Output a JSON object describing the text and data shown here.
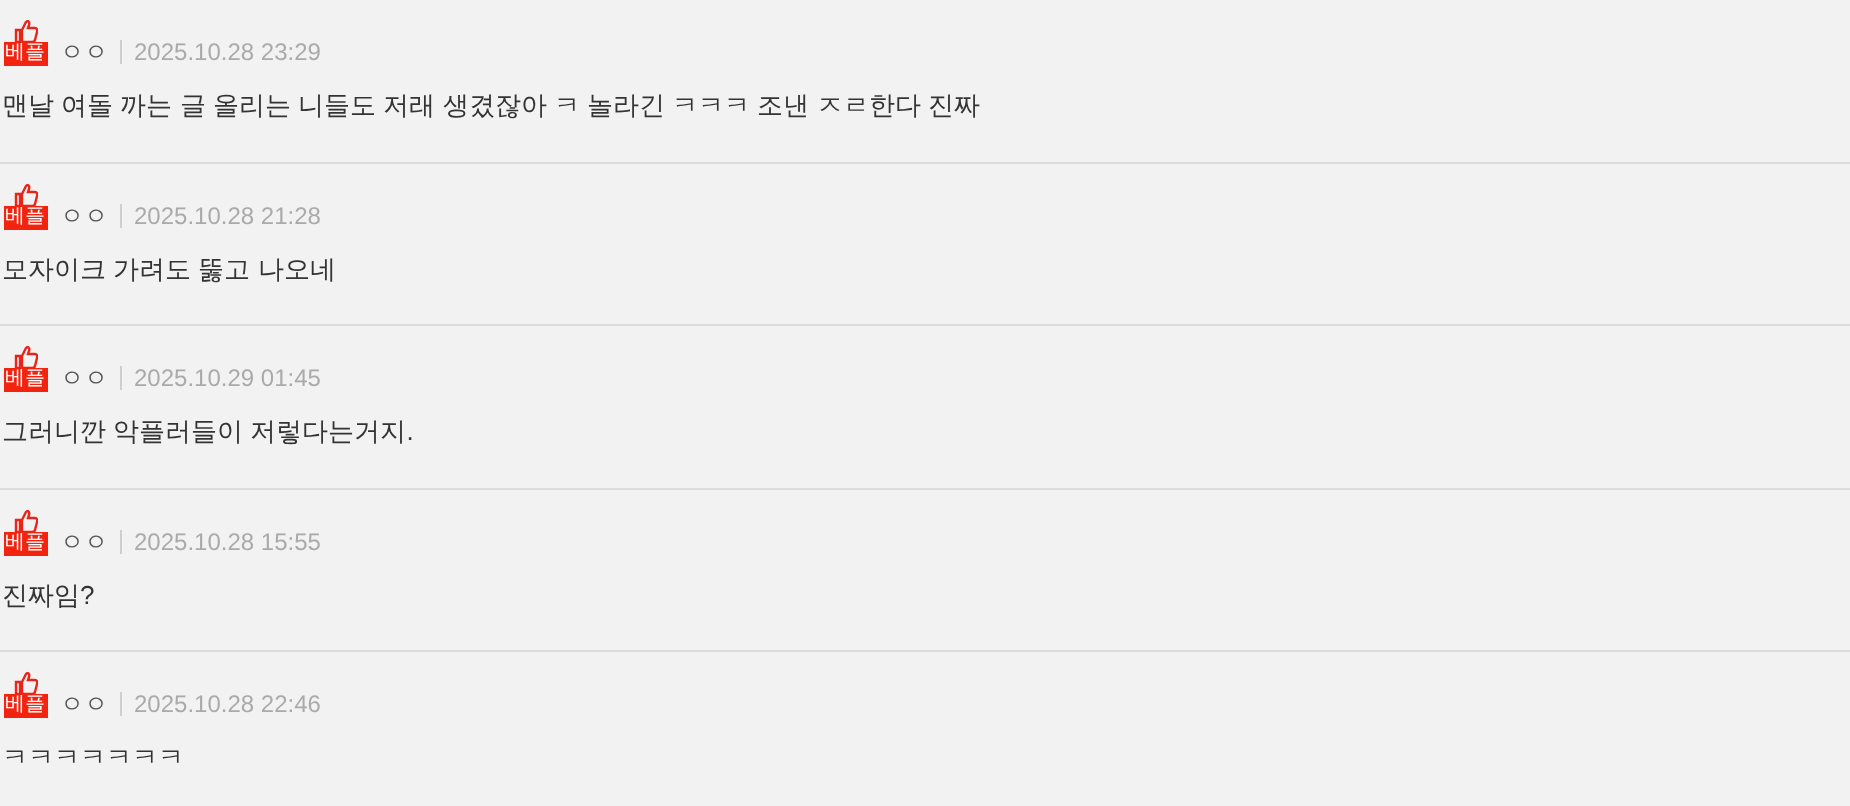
{
  "comments": [
    {
      "badge": "베플",
      "author": "ㅇㅇ",
      "time": "2025.10.28 23:29",
      "text": "맨날 여돌 까는 글 올리는 니들도 저래 생겼잖아 ㅋ 놀라긴 ㅋㅋㅋ 조낸 ㅈㄹ한다 진짜"
    },
    {
      "badge": "베플",
      "author": "ㅇㅇ",
      "time": "2025.10.28 21:28",
      "text": "모자이크 가려도 뚫고 나오네"
    },
    {
      "badge": "베플",
      "author": "ㅇㅇ",
      "time": "2025.10.29 01:45",
      "text": "그러니깐 악플러들이 저렇다는거지."
    },
    {
      "badge": "베플",
      "author": "ㅇㅇ",
      "time": "2025.10.28 15:55",
      "text": "진짜임?"
    },
    {
      "badge": "베플",
      "author": "ㅇㅇ",
      "time": "2025.10.28 22:46",
      "text": "ㅋㅋㅋㅋㅋㅋㅋ"
    }
  ]
}
